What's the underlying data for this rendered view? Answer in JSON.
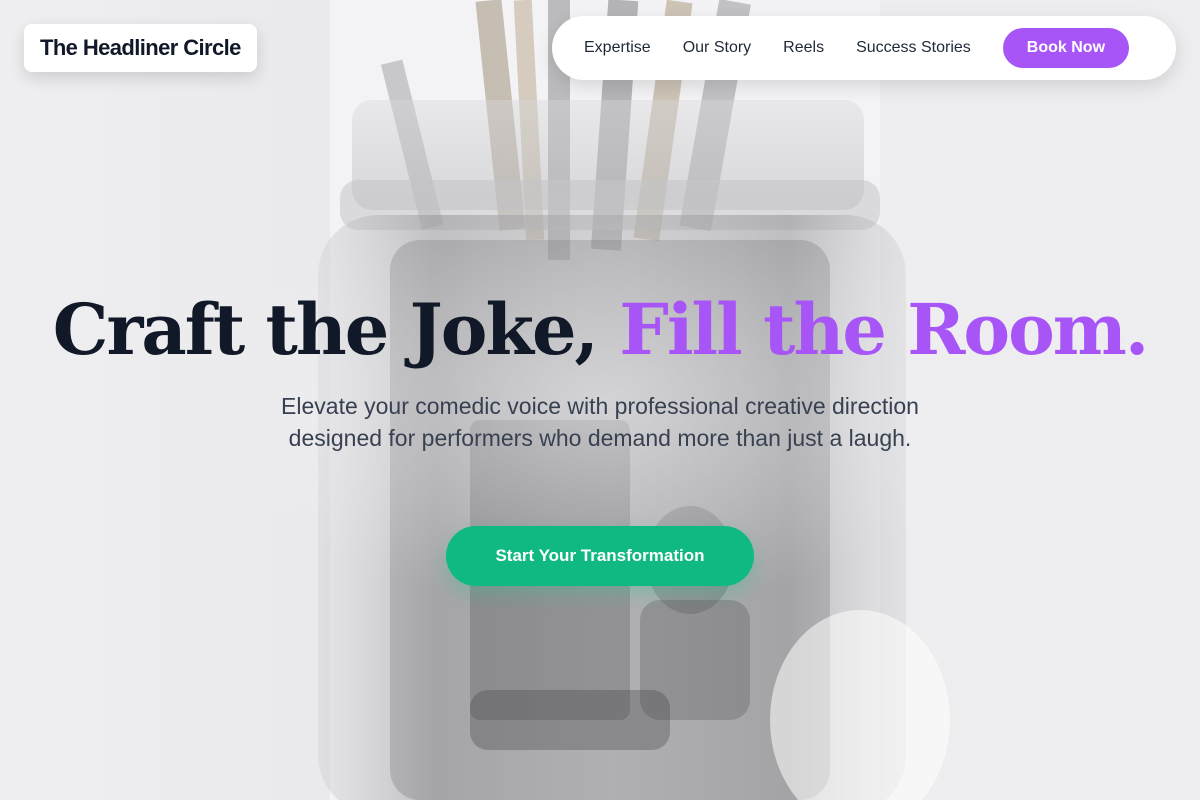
{
  "brand": {
    "name": "The Headliner Circle"
  },
  "nav": {
    "links": [
      "Expertise",
      "Our Story",
      "Reels",
      "Success Stories"
    ],
    "cta_label": "Book Now"
  },
  "hero": {
    "title_part1": "Craft the Joke,",
    "title_accent": "Fill the Room.",
    "subtitle": "Elevate your comedic voice with professional creative direction designed for performers who demand more than just a laugh.",
    "cta_label": "Start Your Transformation",
    "background_image": "glass jar with paint brushes, faded"
  },
  "colors": {
    "accent_purple": "#a855f7",
    "cta_green": "#10b981",
    "text_dark": "#111827",
    "background": "#f3f3f5"
  }
}
